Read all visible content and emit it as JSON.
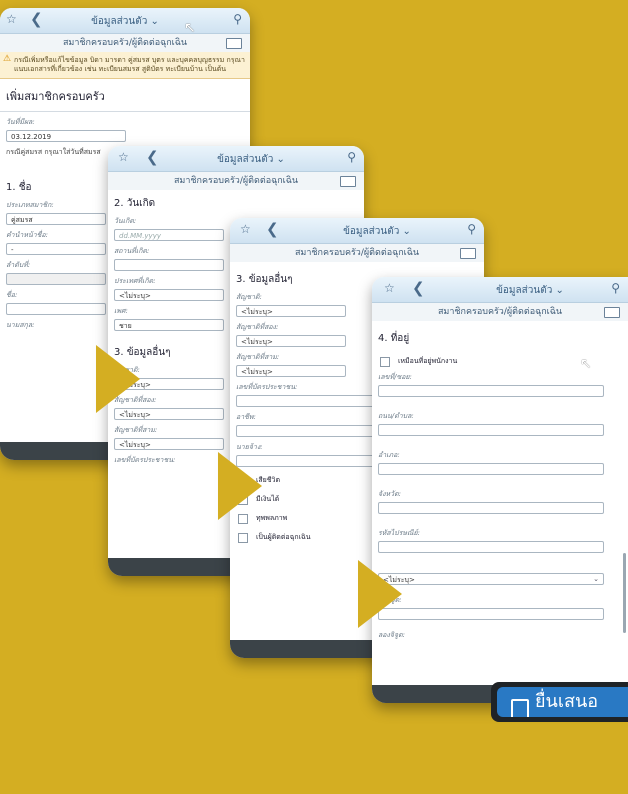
{
  "header_title": "ข้อมูลส่วนตัว",
  "sub_title": "สมาชิกครอบครัว/ผู้ติดต่อฉุกเฉิน",
  "w1": {
    "warning": "กรณีเพิ่มหรือแก้ไขข้อมูล บิดา มารดา คู่สมรส บุตร และบุคคลบุญธรรม กรุณาแนบเอกสารที่เกี่ยวข้อง เช่น ทะเบียนสมรส สูติบัตร ทะเบียนบ้าน เป็นต้น",
    "heading": "เพิ่มสมาชิกครอบครัว",
    "eff_label": "วันที่มีผล:",
    "eff_value": "03.12.2019",
    "note": "กรณีคู่สมรส กรุณาใส่วันที่สมรส",
    "sec1": "1. ชื่อ",
    "member_label": "ประเภทสมาชิก:",
    "member_value": "คู่สมรส",
    "prefix_label": "คำนำหน้าชื่อ:",
    "prefix_value": "-",
    "order_label": "ลำดับที่:",
    "first_label": "ชื่อ:",
    "last_label": "นามสกุล:"
  },
  "w2": {
    "sec2": "2. วันเกิด",
    "dob_label": "วันเกิด:",
    "dob_placeholder": "dd.MM.yyyy",
    "pob_label": "สถานที่เกิด:",
    "country_label": "ประเทศที่เกิด:",
    "country_value": "<ไม่ระบุ>",
    "sex_label": "เพศ:",
    "sex_value": "ชาย",
    "sec3": "3. ข้อมูลอื่นๆ",
    "nat_label": "สัญชาติ:",
    "nat_value": "<ไม่ระบุ>",
    "nat2_label": "สัญชาติที่สอง:",
    "nat2_value": "<ไม่ระบุ>",
    "nat3_label": "สัญชาติที่สาม:",
    "nat3_value": "<ไม่ระบุ>",
    "id_label": "เลขที่บัตรประชาชน:"
  },
  "w3": {
    "sec3": "3. ข้อมูลอื่นๆ",
    "nat_label": "สัญชาติ:",
    "nat_value": "<ไม่ระบุ>",
    "nat2_label": "สัญชาติที่สอง:",
    "nat2_value": "<ไม่ระบุ>",
    "nat3_label": "สัญชาติที่สาม:",
    "nat3_value": "<ไม่ระบุ>",
    "id_label": "เลขที่บัตรประชาชน:",
    "job_label": "อาชีพ:",
    "employer_label": "นายจ้าง:",
    "chk1": "เสียชีวิต",
    "chk2": "มีเงินได้",
    "chk3": "ทุพพลภาพ",
    "chk4": "เป็นผู้ติดต่อฉุกเฉิน"
  },
  "w4": {
    "sec4": "4. ที่อยู่",
    "same_addr": "เหมือนที่อยู่พนักงาน",
    "no_label": "เลขที่/ซอย:",
    "road_label": "ถนน/ตำบล:",
    "district_label": "อำเภอ:",
    "province_label": "จังหวัด:",
    "zip_label": "รหัสไปรษณีย์:",
    "country_value": "<ไม่ระบุ>",
    "lat_label": "ละติจูด:",
    "long_label": "ลองจิจูด:"
  },
  "submit_label": "ยื่นเสนอ"
}
